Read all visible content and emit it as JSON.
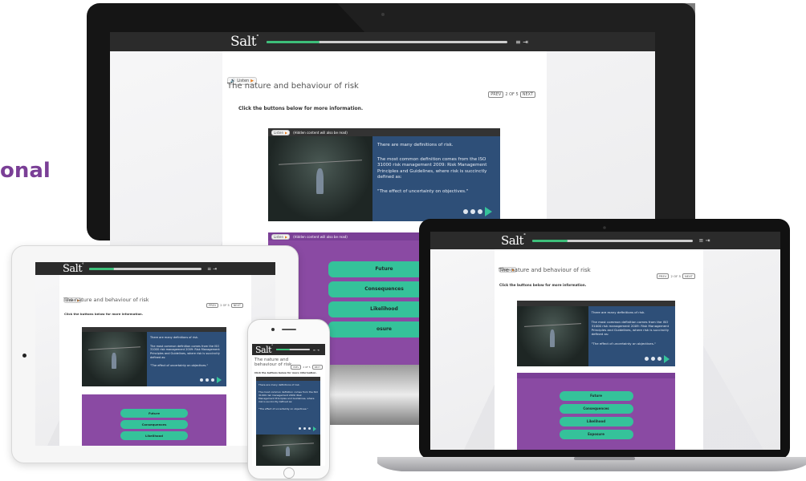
{
  "promo": {
    "text": "onal"
  },
  "app": {
    "logo": "Salt",
    "logo_mark": "°",
    "progress": 0.22,
    "toolbar_icons": "≡ ⇥",
    "listen_label": "Listen",
    "audio_note": "(Hidden content will also be read)",
    "title": "The nature and behaviour of risk",
    "title_phone_line1": "The nature and",
    "title_phone_line2": "behaviour of risk",
    "nav": {
      "prev": "PREV",
      "page": "2 OF 5",
      "next": "NEXT"
    },
    "instruction": "Click the buttons below for more information.",
    "info": {
      "p1": "There are many definitions of risk.",
      "p2": "The most common definition comes from the ISO 31000 risk management 2009: Risk Management Principles and Guidelines, where risk is succinctly defined as:",
      "p3": "\"The effect of uncertainty on objectives.\""
    },
    "buttons": [
      "Future",
      "Consequences",
      "Likelihood",
      "Exposure"
    ],
    "monitor_last_button": "osure"
  },
  "colors": {
    "accent": "#3dbf7a",
    "purple": "#8a4aa3",
    "info_blue": "#2e4f78",
    "teal_button": "#35c29a",
    "promo": "#7a3f96"
  }
}
